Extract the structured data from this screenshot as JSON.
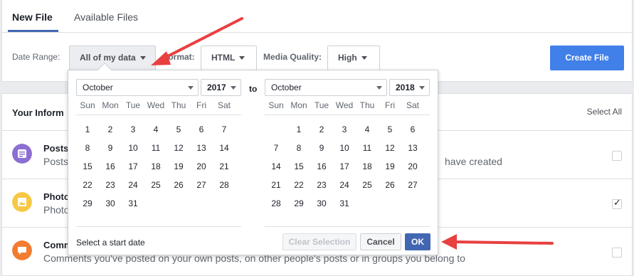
{
  "tabs": [
    {
      "label": "New File"
    },
    {
      "label": "Available Files"
    }
  ],
  "controls": {
    "date_range_label": "Date Range:",
    "date_range_value": "All of my data",
    "format_label": "Format:",
    "format_value": "HTML",
    "media_quality_label": "Media Quality:",
    "media_quality_value": "High",
    "create_file_label": "Create File"
  },
  "info": {
    "title": "Your Inform",
    "select_all": "Select All",
    "rows": [
      {
        "title": "Posts",
        "desc": "Posts",
        "desc_tail": "have created",
        "checked": false,
        "icon": "posts-icon",
        "color": "#8b6fd3"
      },
      {
        "title": "Photo",
        "desc": "Photo",
        "checked": true,
        "icon": "photos-icon",
        "color": "#f7c845"
      },
      {
        "title": "Comm",
        "desc": "Comments you've posted on your own posts, on other people's posts or in groups you belong to",
        "checked": false,
        "icon": "comments-icon",
        "color": "#f27c31"
      }
    ]
  },
  "calendar": {
    "to_label": "to",
    "weekdays": [
      "Sun",
      "Mon",
      "Tue",
      "Wed",
      "Thu",
      "Fri",
      "Sat"
    ],
    "left": {
      "month": "October",
      "year": "2017",
      "weeks": [
        [
          "1",
          "2",
          "3",
          "4",
          "5",
          "6",
          "7"
        ],
        [
          "8",
          "9",
          "10",
          "11",
          "12",
          "13",
          "14"
        ],
        [
          "15",
          "16",
          "17",
          "18",
          "19",
          "20",
          "21"
        ],
        [
          "22",
          "23",
          "24",
          "25",
          "26",
          "27",
          "28"
        ],
        [
          "29",
          "30",
          "31",
          "",
          "",
          "",
          ""
        ]
      ]
    },
    "right": {
      "month": "October",
      "year": "2018",
      "weeks": [
        [
          "",
          "1",
          "2",
          "3",
          "4",
          "5",
          "6"
        ],
        [
          "7",
          "8",
          "9",
          "10",
          "11",
          "12",
          "13"
        ],
        [
          "14",
          "15",
          "16",
          "17",
          "18",
          "19",
          "20"
        ],
        [
          "21",
          "22",
          "23",
          "24",
          "25",
          "26",
          "27"
        ],
        [
          "28",
          "29",
          "30",
          "31",
          "",
          "",
          ""
        ]
      ]
    },
    "hint": "Select a start date",
    "clear_label": "Clear Selection",
    "cancel_label": "Cancel",
    "ok_label": "OK"
  },
  "colors": {
    "accent": "#4267b2",
    "create_button": "#4080e8",
    "annotation_arrow": "#e8403f"
  }
}
